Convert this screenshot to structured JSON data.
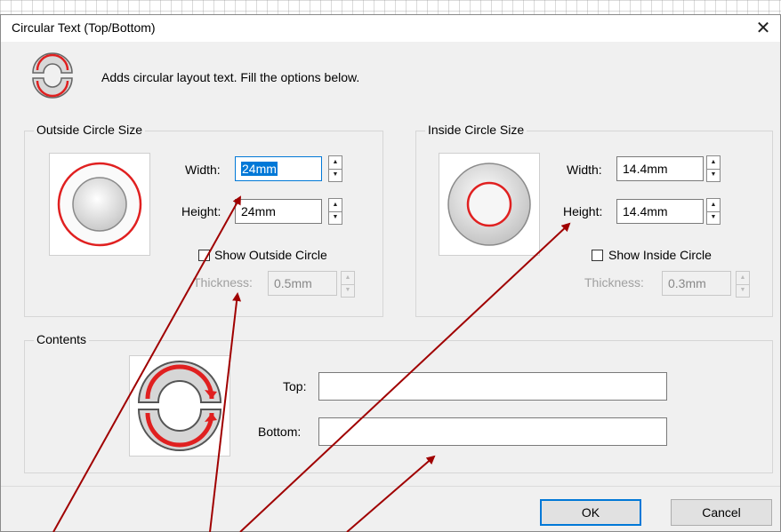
{
  "dialog": {
    "title": "Circular Text (Top/Bottom)",
    "description": "Adds circular layout text.  Fill the options below."
  },
  "outside": {
    "group_label": "Outside Circle Size",
    "width_label": "Width:",
    "width_value": "24mm",
    "height_label": "Height:",
    "height_value": "24mm",
    "show_label": "Show Outside Circle",
    "show_checked": false,
    "thickness_label": "Thickness:",
    "thickness_value": "0.5mm"
  },
  "inside": {
    "group_label": "Inside Circle Size",
    "width_label": "Width:",
    "width_value": "14.4mm",
    "height_label": "Height:",
    "height_value": "14.4mm",
    "show_label": "Show Inside Circle",
    "show_checked": false,
    "thickness_label": "Thickness:",
    "thickness_value": "0.3mm"
  },
  "contents": {
    "group_label": "Contents",
    "top_label": "Top:",
    "top_value": "",
    "bottom_label": "Bottom:",
    "bottom_value": ""
  },
  "buttons": {
    "ok": "OK",
    "cancel": "Cancel"
  },
  "icons": {
    "close": "close-icon",
    "circular_text": "circular-text-icon",
    "outside_preview": "outside-circle-preview-icon",
    "inside_preview": "inside-circle-preview-icon",
    "contents_preview": "circular-text-preview-icon"
  },
  "colors": {
    "accent": "#0078d7",
    "circle_red": "#e02020",
    "annotation_arrow": "#a00000",
    "dialog_bg": "#f0f0f0"
  }
}
